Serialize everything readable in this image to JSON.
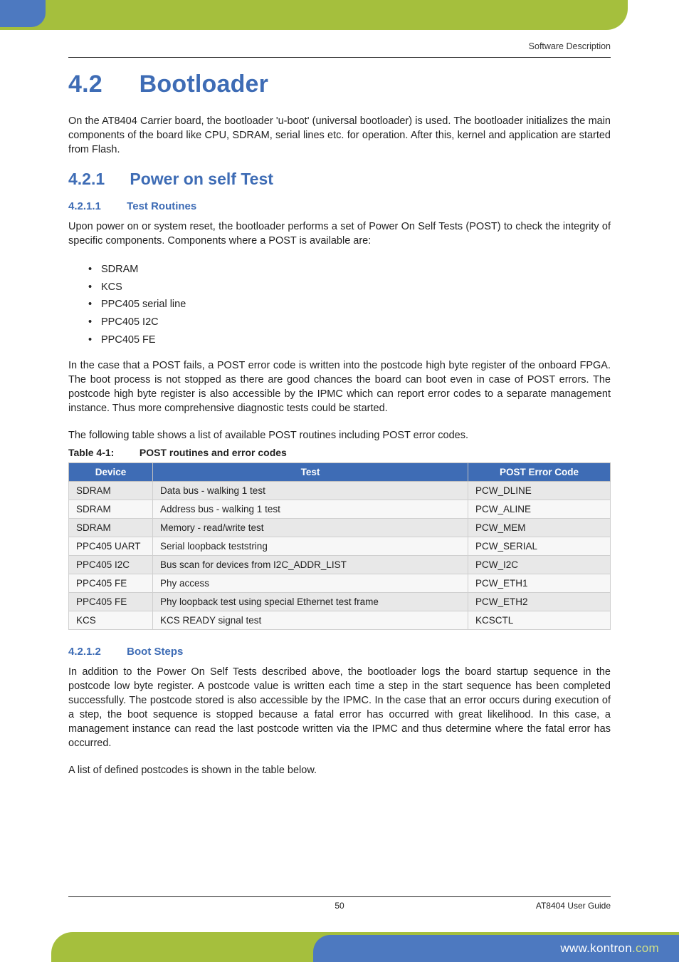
{
  "running_head": "Software Description",
  "h1": {
    "num": "4.2",
    "title": "Bootloader"
  },
  "p1": "On the AT8404 Carrier board, the bootloader 'u-boot' (universal bootloader) is used. The bootloader initializes the main components of the board like CPU, SDRAM, serial lines etc. for operation. After this, kernel and application are started from Flash.",
  "h2": {
    "num": "4.2.1",
    "title": "Power on self Test"
  },
  "h3a": {
    "num": "4.2.1.1",
    "title": "Test Routines"
  },
  "p2": "Upon power on or system reset, the bootloader performs a set of Power On Self Tests (POST) to check the integrity of specific components. Components where a POST is available are:",
  "bullets": [
    "SDRAM",
    "KCS",
    "PPC405 serial line",
    "PPC405 I2C",
    "PPC405 FE"
  ],
  "p3": "In the case that a POST fails, a POST error code is written into the postcode high byte register of the onboard FPGA. The boot process is not stopped as there are good chances the board can boot even in case of POST errors. The postcode high byte register is also accessible by the IPMC which can report error codes to a separate management instance. Thus more comprehensive diagnostic tests could be started.",
  "p4": "The following table shows a list of available POST routines including POST error codes.",
  "table_caption": {
    "label": "Table 4-1:",
    "title": "POST routines and error codes"
  },
  "table": {
    "headers": [
      "Device",
      "Test",
      "POST Error Code"
    ],
    "rows": [
      [
        "SDRAM",
        "Data bus - walking 1 test",
        "PCW_DLINE"
      ],
      [
        "SDRAM",
        "Address bus - walking 1 test",
        "PCW_ALINE"
      ],
      [
        "SDRAM",
        "Memory - read/write test",
        "PCW_MEM"
      ],
      [
        "PPC405 UART",
        "Serial loopback teststring",
        "PCW_SERIAL"
      ],
      [
        "PPC405 I2C",
        "Bus scan for devices from I2C_ADDR_LIST",
        "PCW_I2C"
      ],
      [
        "PPC405 FE",
        "Phy access",
        "PCW_ETH1"
      ],
      [
        "PPC405 FE",
        "Phy loopback test using special Ethernet test frame",
        "PCW_ETH2"
      ],
      [
        "KCS",
        "KCS READY signal test",
        "KCSCTL"
      ]
    ]
  },
  "h3b": {
    "num": "4.2.1.2",
    "title": "Boot Steps"
  },
  "p5": "In addition to the Power On Self Tests described above, the bootloader logs the board startup sequence in the postcode low byte register. A postcode value is written each time a step in the start sequence has been completed successfully. The postcode stored is also accessible by the IPMC. In the case that an error occurs during execution of a step, the boot sequence is stopped because a fatal error has occurred with great likelihood. In this case, a management instance can read the last postcode written via the IPMC and thus determine where the fatal error has occurred.",
  "p6": "A list of defined postcodes is shown in the table below.",
  "footer": {
    "page": "50",
    "doc": "AT8404 User Guide",
    "url_w": "www.",
    "url_d": "kontron",
    "url_c": ".com"
  }
}
